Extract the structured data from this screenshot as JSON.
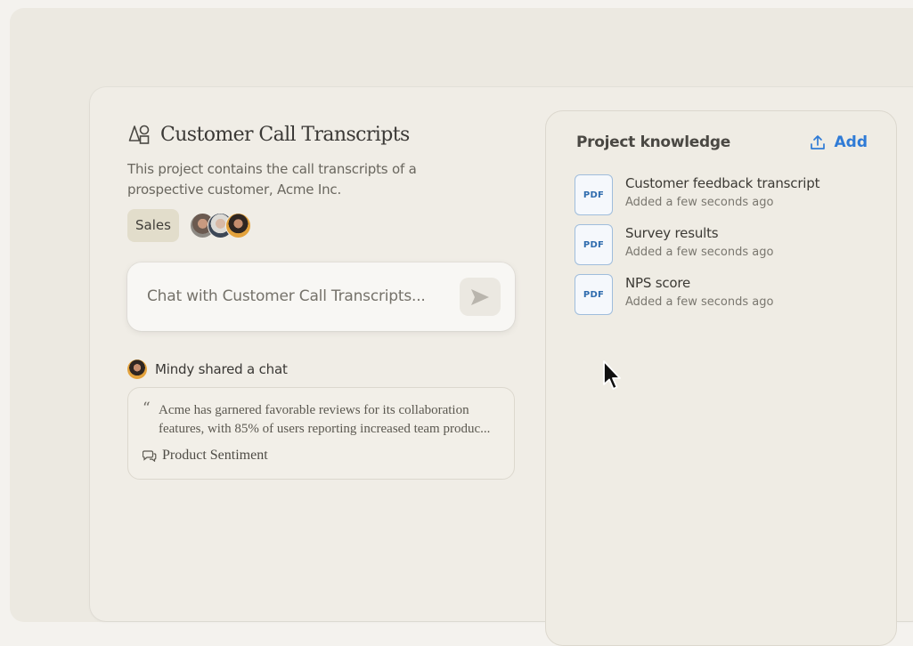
{
  "project": {
    "title": "Customer Call Transcripts",
    "description": "This project contains the call transcripts of a prospective customer, Acme Inc.",
    "tag": "Sales",
    "icon": "shapes-icon"
  },
  "chat": {
    "placeholder": "Chat with Customer Call Transcripts...",
    "send_icon": "send-icon"
  },
  "shared": {
    "label": "Mindy shared a chat",
    "quote": "Acme has garnered favorable reviews for its collaboration features, with 85% of users reporting increased team produc...",
    "chat_title": "Product Sentiment",
    "quote_mark": "“"
  },
  "knowledge": {
    "title": "Project knowledge",
    "add_label": "Add",
    "documents": [
      {
        "name": "Customer feedback transcript",
        "meta": "Added a few seconds ago",
        "type": "PDF"
      },
      {
        "name": "Survey results",
        "meta": "Added a few seconds ago",
        "type": "PDF"
      },
      {
        "name": "NPS score",
        "meta": "Added a few seconds ago",
        "type": "PDF"
      }
    ]
  },
  "colors": {
    "accent": "#2f7bd6",
    "background": "#f0ede6",
    "tag": "#e2ddcb"
  }
}
